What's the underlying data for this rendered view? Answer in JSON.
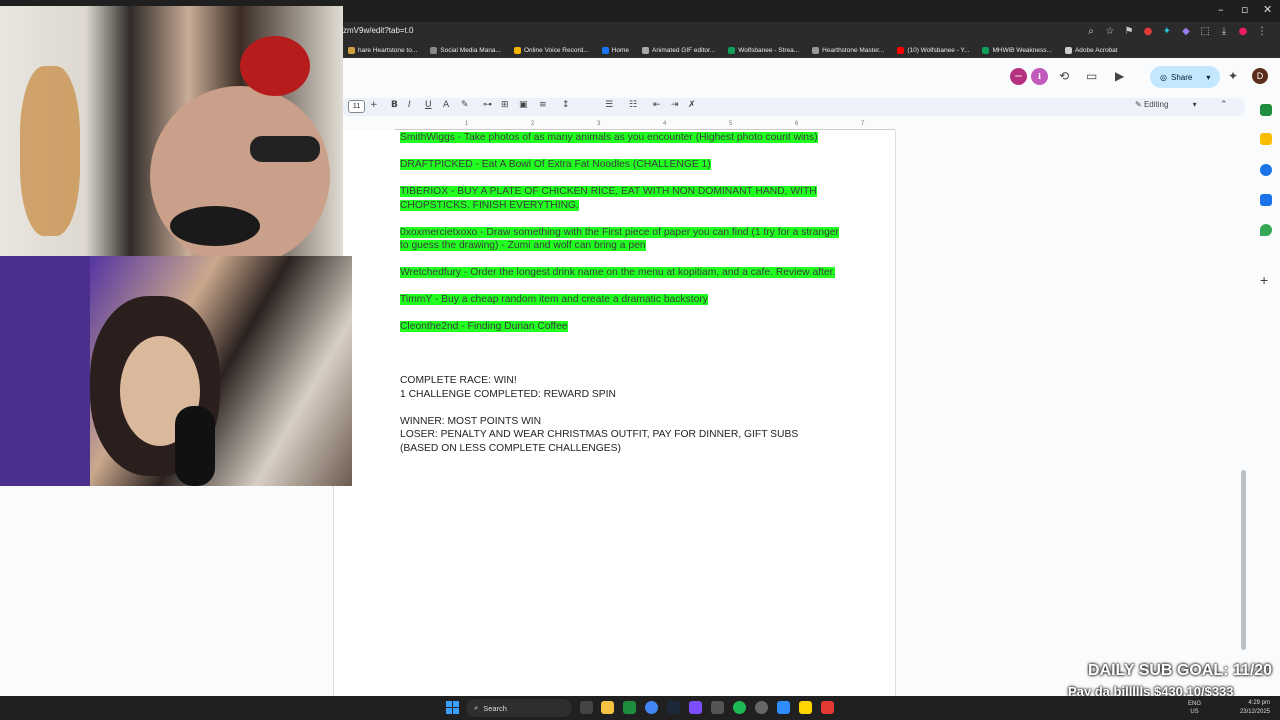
{
  "browser": {
    "url": "zmV9w/edit?tab=t.0",
    "bookmarks": [
      {
        "label": "hare Heartstone to...",
        "color": "#d0a040"
      },
      {
        "label": "Social Media Mana...",
        "color": "#888888"
      },
      {
        "label": "Online Voice Record...",
        "color": "#f4b400"
      },
      {
        "label": "Home",
        "color": "#1877f2"
      },
      {
        "label": "Animated GIF editor...",
        "color": "#aaaaaa"
      },
      {
        "label": "Wolfsbanee - Strea...",
        "color": "#0f9d58"
      },
      {
        "label": "Hearthstone Master...",
        "color": "#999999"
      },
      {
        "label": "(10) Wolfsbanee - Y...",
        "color": "#ff0000"
      },
      {
        "label": "MHWiB Weakness...",
        "color": "#0f9d58"
      },
      {
        "label": "Adobe Acrobat",
        "color": "#cccccc"
      }
    ]
  },
  "docs": {
    "share_label": "Share",
    "font_size": "11",
    "mode_label": "Editing",
    "user_initial": "D",
    "ruler_numbers": [
      "1",
      "2",
      "3",
      "4",
      "5",
      "6",
      "7"
    ]
  },
  "document": {
    "highlighted": [
      "SmithWiggs - Take photos of as many animals as you encounter (Highest photo count wins)",
      "DRAFTPICKED - Eat A Bowl Of Extra Fat Noodles (CHALLENGE 1)",
      "TIBERIOX - BUY A PLATE OF CHICKEN RICE, EAT WITH NON DOMINANT HAND, WITH CHOPSTICKS. FINISH EVERYTHING.",
      "0xoxmercietxoxo - Draw something with the First piece of paper you can find (1 try for a stranger to guess the drawing) - Zumi and wolf can bring a pen",
      "Wretchedfury - Order the longest drink name on the menu at kopitiam, and a cafe. Review after.",
      "TimmY - Buy a cheap random item and create a dramatic backstory",
      "Cleonthe2nd - Finding Durian Coffee"
    ],
    "rules_1": [
      "COMPLETE RACE: WIN!",
      "1 CHALLENGE COMPLETED: REWARD SPIN"
    ],
    "rules_2": [
      "WINNER: MOST POINTS WIN",
      "LOSER: PENALTY AND WEAR CHRISTMAS OUTFIT, PAY FOR DINNER, GIFT SUBS",
      "(BASED ON LESS COMPLETE CHALLENGES)"
    ]
  },
  "overlay": {
    "sub_goal": "DAILY SUB GOAL: 11/20",
    "bills": "Pay da billllls $430.10/$333"
  },
  "taskbar": {
    "search_label": "Search",
    "lang_line1": "ENG",
    "lang_line2": "US",
    "time": "4:29 pm",
    "date": "23/12/2025"
  }
}
